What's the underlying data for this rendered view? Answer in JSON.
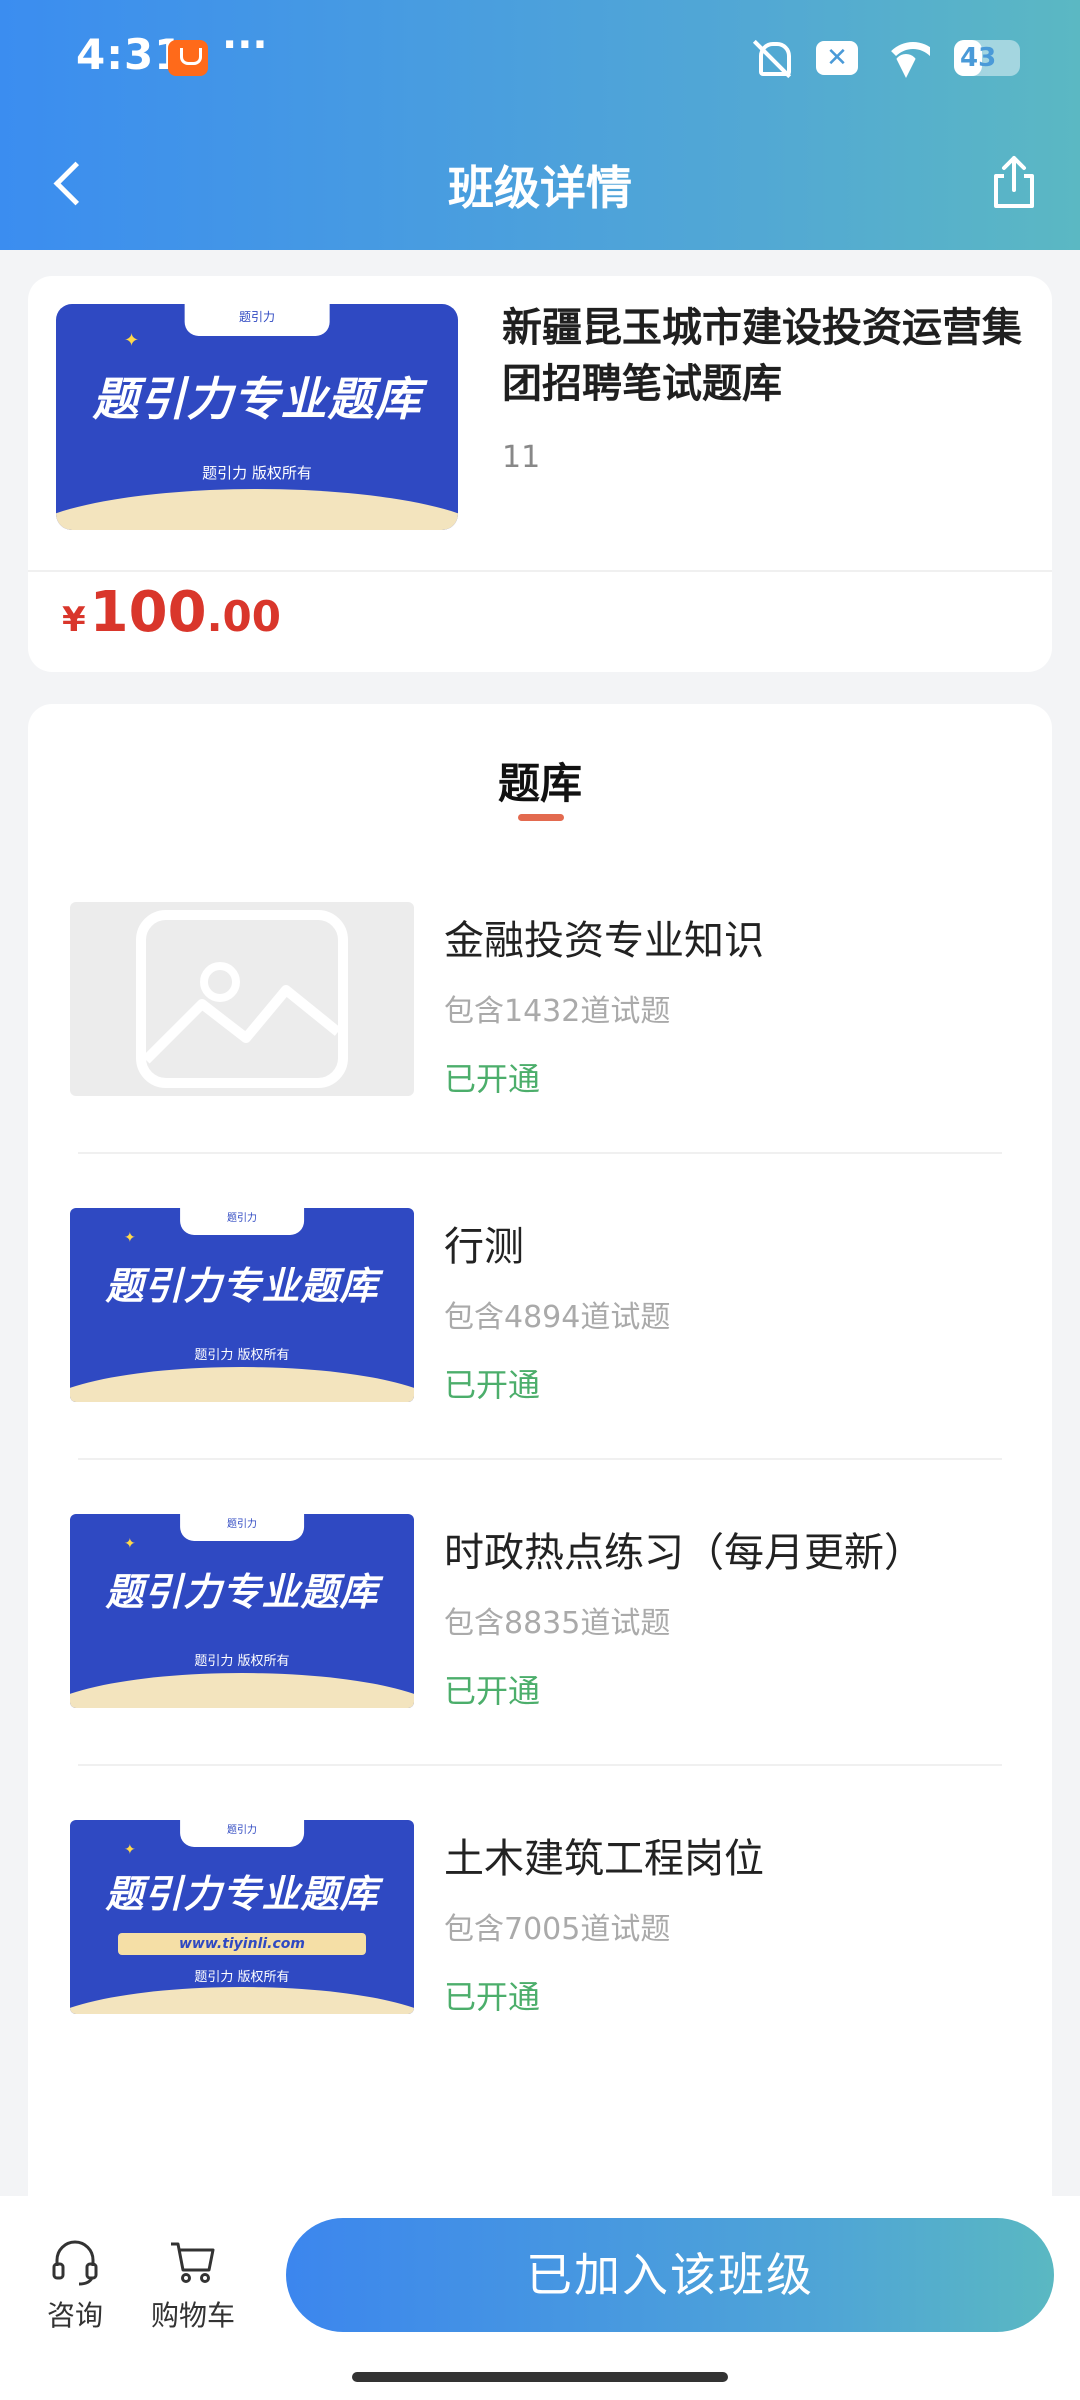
{
  "status_bar": {
    "time": "4:31",
    "dots": "···",
    "x_badge": "✕",
    "battery": "43",
    "battery_level": 0.43
  },
  "header": {
    "title": "班级详情"
  },
  "course": {
    "title": "新疆昆玉城市建设投资运营集团招聘笔试题库",
    "count": "11",
    "price": {
      "symbol": "¥",
      "integer": "100",
      "decimal": ".00"
    },
    "cover": {
      "tab": "题引力",
      "main": "题引力专业题库",
      "sub": "题引力 版权所有"
    }
  },
  "bank_section": {
    "title": "题库",
    "items": [
      {
        "name": "金融投资专业知识",
        "count": "包含1432道试题",
        "status": "已开通",
        "thumb": "placeholder"
      },
      {
        "name": "行测",
        "count": "包含4894道试题",
        "status": "已开通",
        "thumb": "banner",
        "banner": {
          "tab": "题引力",
          "main": "题引力专业题库",
          "sub": "题引力 版权所有"
        }
      },
      {
        "name": "时政热点练习（每月更新）",
        "count": "包含8835道试题",
        "status": "已开通",
        "thumb": "banner",
        "banner": {
          "tab": "题引力",
          "main": "题引力专业题库",
          "sub": "题引力 版权所有"
        }
      },
      {
        "name": "土木建筑工程岗位",
        "count": "包含7005道试题",
        "status": "已开通",
        "thumb": "banner-url",
        "banner": {
          "tab": "题引力",
          "main": "题引力专业题库",
          "url": "www.tiyinli.com",
          "sub": "题引力 版权所有"
        }
      }
    ]
  },
  "bottom_bar": {
    "consult_label": "咨询",
    "cart_label": "购物车",
    "join_label": "已加入该班级"
  },
  "colors": {
    "accent": "#3b8df0",
    "price": "#d9362b",
    "status_green": "#4cae6b",
    "banner_blue": "#2f49c2"
  }
}
